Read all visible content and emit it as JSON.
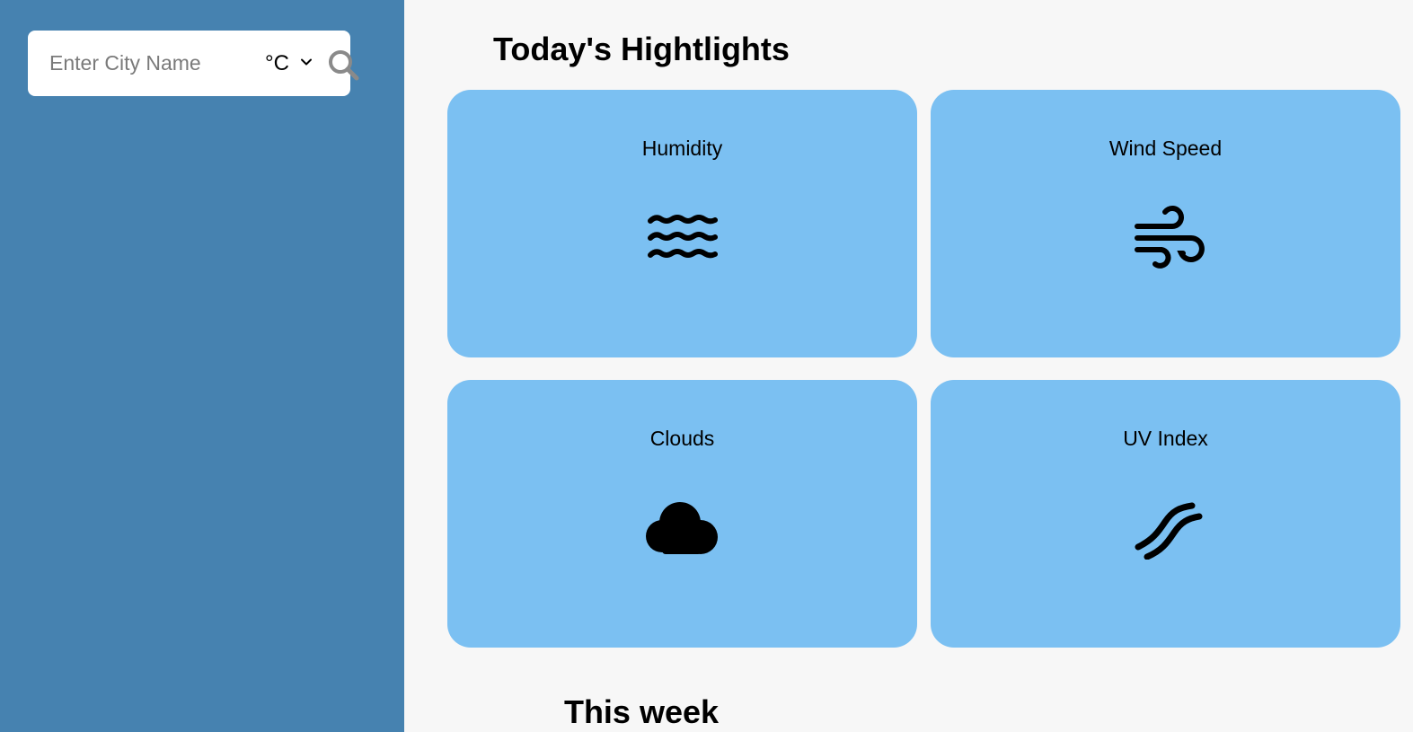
{
  "sidebar": {
    "search": {
      "placeholder": "Enter City Name",
      "value": "",
      "unit_selected": "°C",
      "search_icon": "search-icon"
    }
  },
  "main": {
    "highlights_title": "Today's Hightlights",
    "cards": [
      {
        "label": "Humidity",
        "icon": "water-waves-icon"
      },
      {
        "label": "Wind Speed",
        "icon": "wind-icon"
      },
      {
        "label": "Clouds",
        "icon": "cloud-icon"
      },
      {
        "label": "UV Index",
        "icon": "uv-rays-icon"
      }
    ],
    "week_title": "This week"
  },
  "colors": {
    "sidebar_bg": "#4682b0",
    "main_bg": "#f7f7f7",
    "card_bg": "#7bc0f2",
    "search_box_bg": "#ffffff",
    "search_icon_color": "#8a8a8a"
  }
}
